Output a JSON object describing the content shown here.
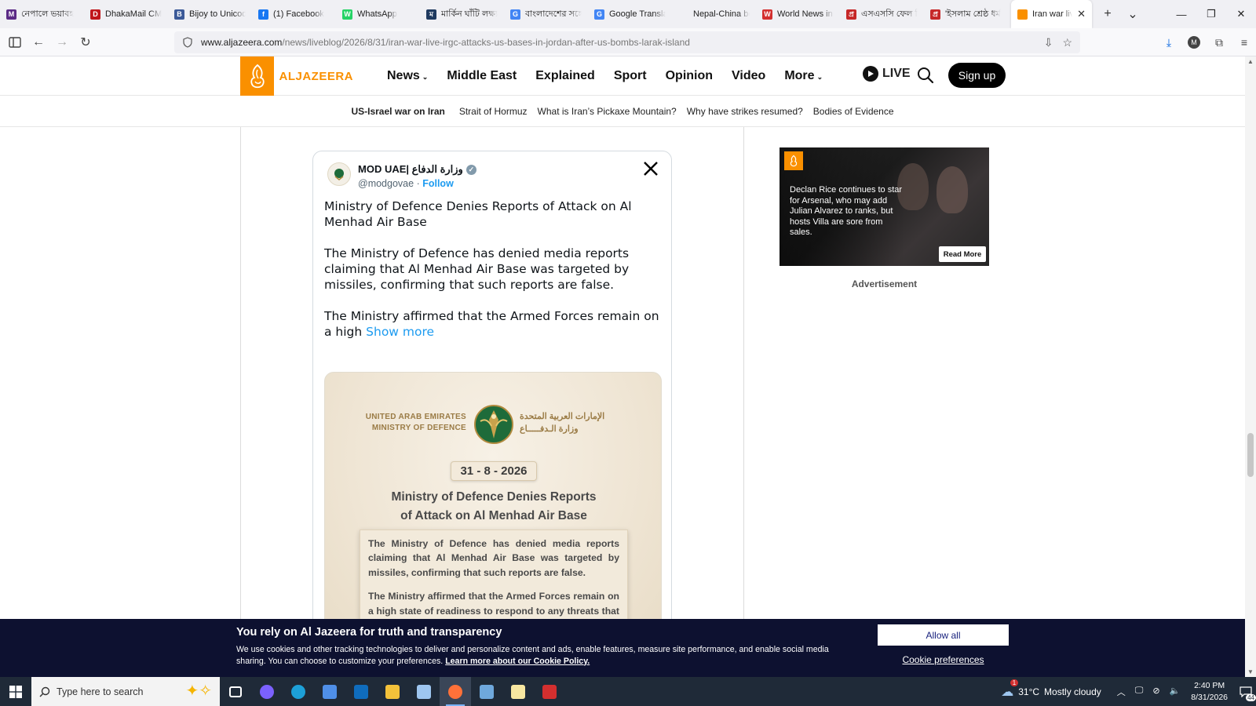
{
  "browser": {
    "tabs": [
      {
        "label": "নেপালে ভয়াবহ",
        "favicon_color": "#5b2a86",
        "favicon_glyph": "M"
      },
      {
        "label": "DhakaMail CMS",
        "favicon_color": "#c0161b",
        "favicon_glyph": "D"
      },
      {
        "label": "Bijoy to Unicode",
        "favicon_color": "#3b5998",
        "favicon_glyph": "B"
      },
      {
        "label": "(1) Facebook",
        "favicon_color": "#1877f2",
        "favicon_glyph": "f"
      },
      {
        "label": "WhatsApp",
        "favicon_color": "#25d366",
        "favicon_glyph": "W"
      },
      {
        "label": "মার্কিন ঘাঁটি লক্ষ্য",
        "favicon_color": "#1f3a5f",
        "favicon_glyph": "ম"
      },
      {
        "label": "বাংলাদেশের সঙ্গে",
        "favicon_color": "#4285f4",
        "favicon_glyph": "G"
      },
      {
        "label": "Google Translate",
        "favicon_color": "#4285f4",
        "favicon_glyph": "G"
      },
      {
        "label": "Nepal-China border",
        "favicon_color": "#f0f0f4",
        "favicon_glyph": ""
      },
      {
        "label": "World News in Bengali",
        "favicon_color": "#d32f2f",
        "favicon_glyph": "W"
      },
      {
        "label": "এসএসসি ফেল ফি",
        "favicon_color": "#c62828",
        "favicon_glyph": "প্র"
      },
      {
        "label": "'ইসলাম শ্রেষ্ঠ ধর্ম",
        "favicon_color": "#c62828",
        "favicon_glyph": "প্র"
      }
    ],
    "active_tab": {
      "label": "Iran war live:",
      "favicon_color": "#fa9000"
    },
    "url_host": "www.aljazeera.com",
    "url_path": "/news/liveblog/2026/8/31/iran-war-live-irgc-attacks-us-bases-in-jordan-after-us-bombs-larak-island",
    "profile_initial": "M"
  },
  "site": {
    "brand": "ALJAZEERA",
    "brand_color": "#fa9000",
    "nav": [
      {
        "label": "News",
        "has_menu": true
      },
      {
        "label": "Middle East",
        "has_menu": false
      },
      {
        "label": "Explained",
        "has_menu": false
      },
      {
        "label": "Sport",
        "has_menu": false
      },
      {
        "label": "Opinion",
        "has_menu": false
      },
      {
        "label": "Video",
        "has_menu": false
      },
      {
        "label": "More",
        "has_menu": true
      }
    ],
    "live_label": "LIVE",
    "signup_label": "Sign up",
    "subnav_lead": "US-Israel war on Iran",
    "subnav": [
      "Strait of Hormuz",
      "What is Iran’s Pickaxe Mountain?",
      "Why have strikes resumed?",
      "Bodies of Evidence"
    ]
  },
  "tweet": {
    "name": "MOD UAE| وزارة الدفاع",
    "handle": "@modgovae",
    "separator": "·",
    "follow": "Follow",
    "paragraphs": [
      "Ministry of Defence Denies Reports of Attack on Al Menhad Air Base",
      "The Ministry of Defence has denied media reports claiming that Al Menhad Air Base was targeted by missiles, confirming that such reports are false."
    ],
    "truncated": "The Ministry affirmed that the Armed Forces remain on a high",
    "show_more": "Show more",
    "media": {
      "en_line1": "UNITED ARAB EMIRATES",
      "en_line2": "MINISTRY OF DEFENCE",
      "ar_line1": "الإمارات العربية المتحدة",
      "ar_line2": "وزارة الـدفـــــاع",
      "date": "31 - 8 - 2026",
      "title_line1": "Ministry of Defence Denies Reports",
      "title_line2": "of Attack on Al Menhad Air Base",
      "box_p1": "The Ministry of Defence has denied media reports claiming that Al Menhad Air Base was targeted by missiles, confirming that such reports are false.",
      "box_p2": "The Ministry affirmed that the Armed Forces remain on a high state of readiness to respond to any threats that may arise, in a manner that safeguards the UAE’s sovereignty, security and stability."
    }
  },
  "ad": {
    "text": "Declan Rice continues to star for Arsenal, who may add Julian Alvarez to ranks, but hosts Villa are sore from sales.",
    "read_more": "Read More",
    "label": "Advertisement"
  },
  "cookie": {
    "title": "You rely on Al Jazeera for truth and transparency",
    "body": "We use cookies and other tracking technologies to deliver and personalize content and ads, enable features, measure site performance, and enable social media sharing. You can choose to customize your preferences. ",
    "link": "Learn more about our Cookie Policy.",
    "allow": "Allow all",
    "prefs": "Cookie preferences"
  },
  "taskbar": {
    "search_placeholder": "Type here to search",
    "weather_temp": "31°C",
    "weather_text": "Mostly cloudy",
    "weather_alert": "1",
    "time": "2:40 PM",
    "date": "8/31/2026",
    "notifications": "44",
    "apps": [
      {
        "name": "task-view",
        "color": "#ffffff"
      },
      {
        "name": "copilot",
        "color": "#7b61ff"
      },
      {
        "name": "edge",
        "color": "#1da0d8"
      },
      {
        "name": "store",
        "color": "#4f8fe8"
      },
      {
        "name": "outlook",
        "color": "#0f6cbd"
      },
      {
        "name": "file-explorer",
        "color": "#f3c13a"
      },
      {
        "name": "notepad-pen",
        "color": "#9ec6f0"
      },
      {
        "name": "firefox",
        "color": "#ff7139"
      },
      {
        "name": "remote-desktop",
        "color": "#6fa8dc"
      },
      {
        "name": "sticky-notes",
        "color": "#f7e7a1"
      },
      {
        "name": "bangla-keyboard",
        "color": "#d32f2f"
      }
    ]
  }
}
